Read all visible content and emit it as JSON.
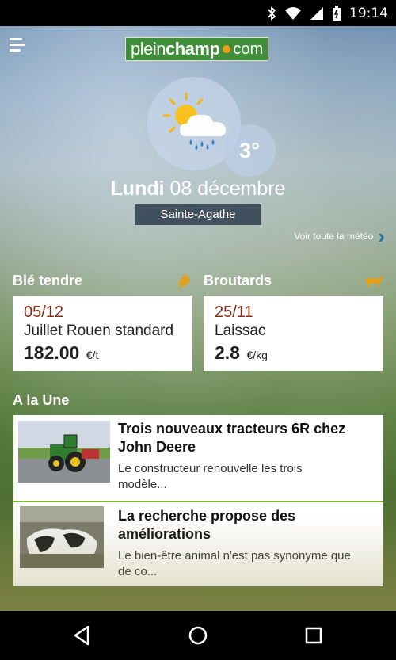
{
  "status_bar": {
    "time": "19:14"
  },
  "header": {
    "logo": {
      "part1": "plein",
      "part2": "champ",
      "part3": "com"
    }
  },
  "weather": {
    "temperature": "3°",
    "day": "Lundi",
    "date": "08 décembre",
    "location": "Sainte-Agathe",
    "see_all_label": "Voir toute la météo",
    "icon": "sun-cloud-rain-icon"
  },
  "prices": [
    {
      "title": "Blé tendre",
      "icon": "wheat-icon",
      "date": "05/12",
      "place": "Juillet Rouen standard",
      "value": "182.00",
      "unit": "€/t"
    },
    {
      "title": "Broutards",
      "icon": "cow-icon",
      "date": "25/11",
      "place": "Laissac",
      "value": "2.8",
      "unit": "€/kg"
    }
  ],
  "news": {
    "section_title": "A la Une",
    "items": [
      {
        "title_line1": "Trois nouveaux tracteurs 6R chez",
        "title_line2": "John Deere",
        "excerpt_line1": "Le constructeur renouvelle les trois",
        "excerpt_line2": "modèle..."
      },
      {
        "title_line1": "La recherche propose des",
        "title_line2": "améliorations",
        "excerpt_line1": "Le bien-être animal n'est pas synonyme que",
        "excerpt_line2": "de co..."
      }
    ]
  },
  "colors": {
    "accent": "#3f8f3a",
    "price_date": "#8b2a12",
    "icon_gold": "#e0a020",
    "link_chevron": "#2b6fa6"
  }
}
